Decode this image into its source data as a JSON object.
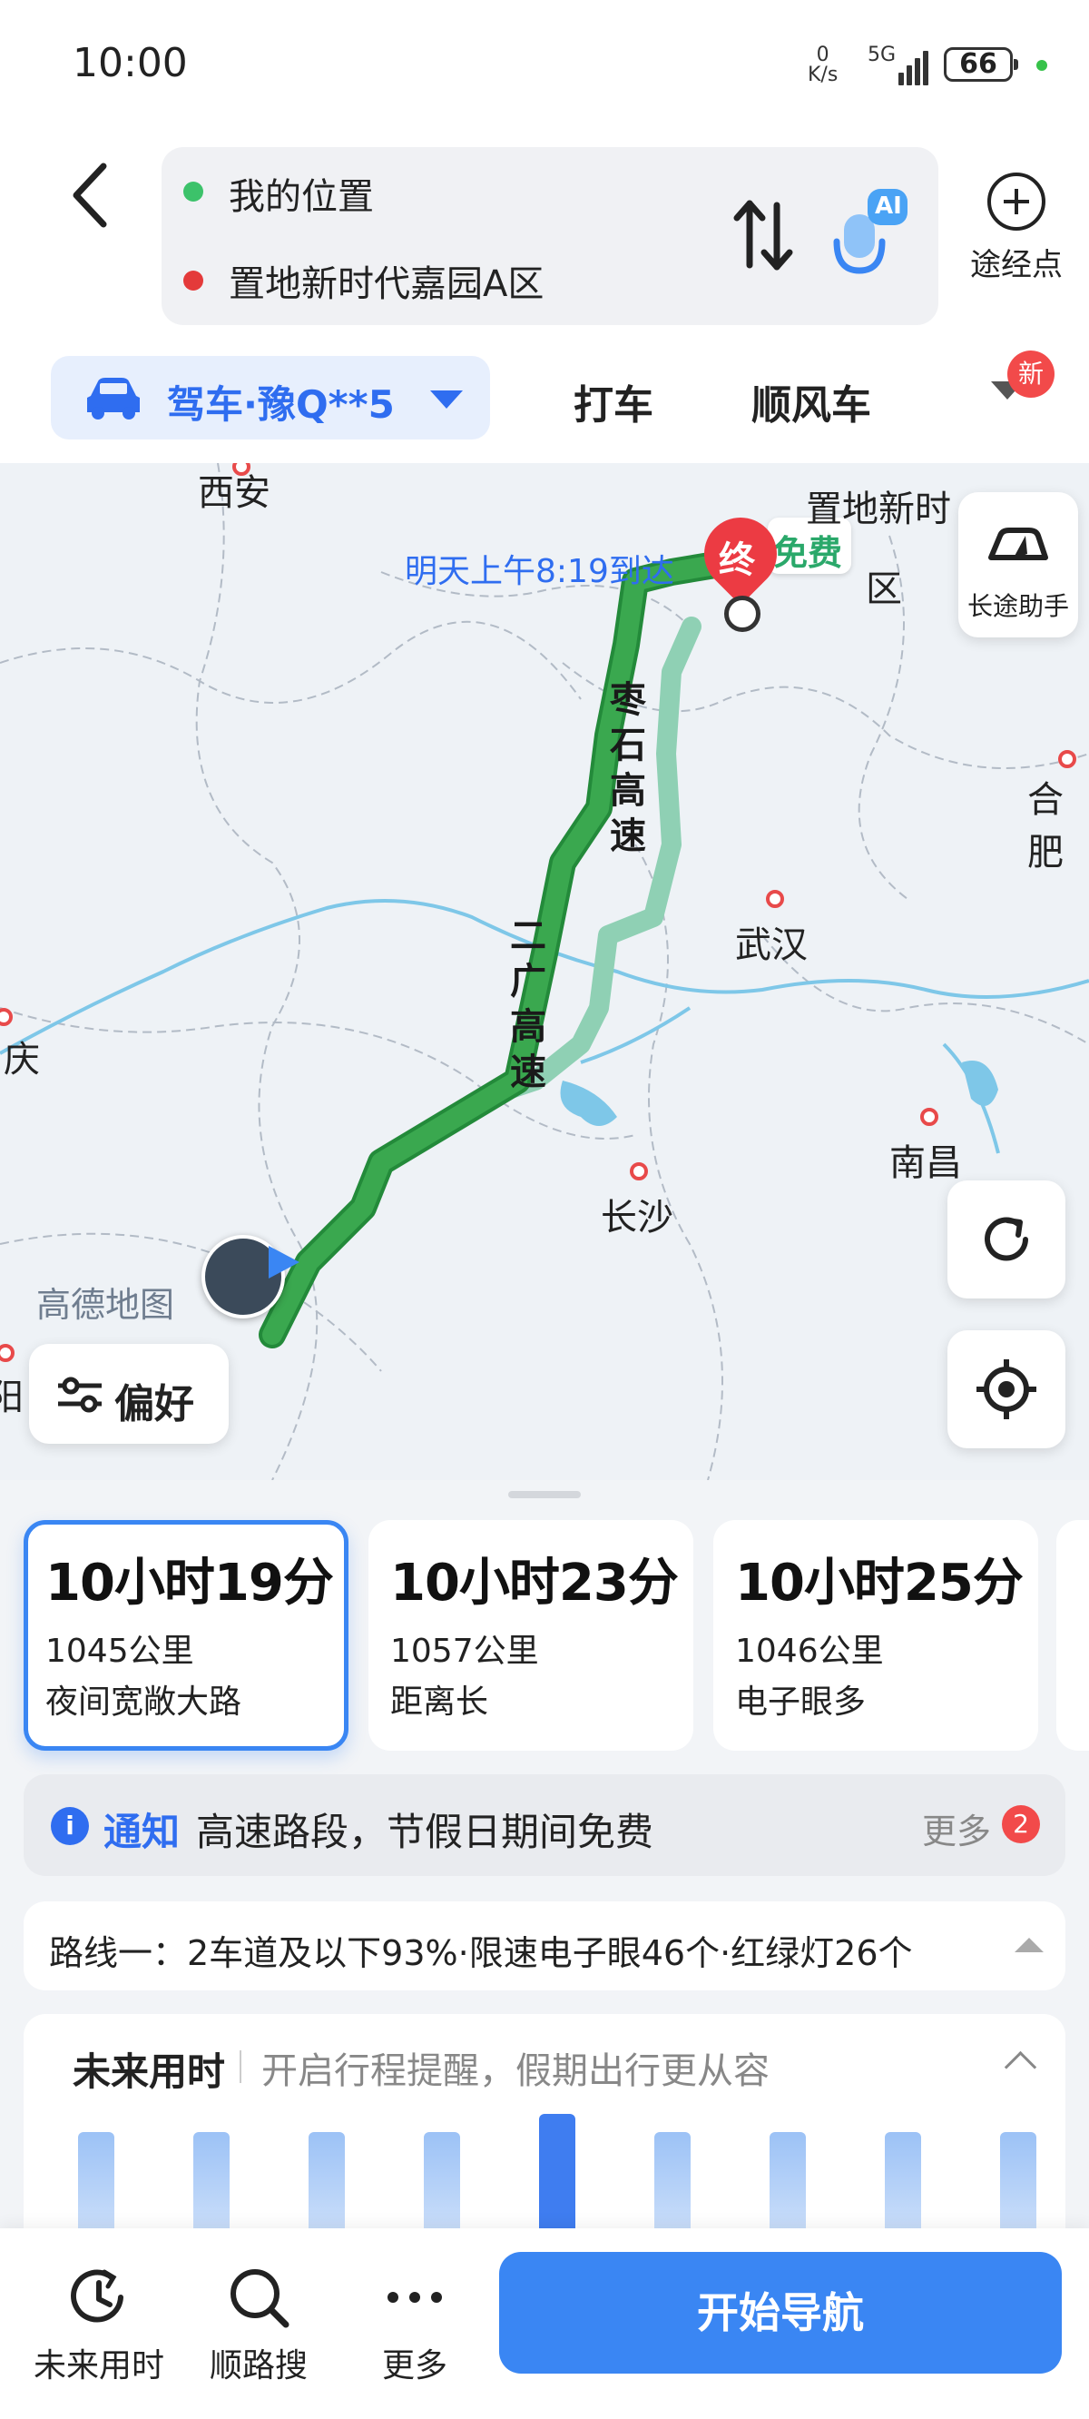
{
  "status_bar": {
    "time": "10:00",
    "net_speed_value": "0",
    "net_speed_unit": "K/s",
    "signal": "5G",
    "battery": "66"
  },
  "header": {
    "origin": "我的位置",
    "destination": "置地新时代嘉园A区",
    "ai_badge": "AI",
    "via_label": "途经点"
  },
  "modes": {
    "drive": "驾车·豫Q**5",
    "taxi": "打车",
    "carpool": "顺风车",
    "new_badge": "新"
  },
  "map": {
    "eta": "明天上午8:19到达",
    "end_marker": "终",
    "toll_free": "免费",
    "dest_label_1": "置地新时",
    "dest_label_2": "区",
    "road_1": [
      "枣",
      "石",
      "高",
      "速"
    ],
    "road_2": [
      "二",
      "广",
      "高",
      "速"
    ],
    "cities": {
      "xian": "西安",
      "wuhan": "武汉",
      "changsha": "长沙",
      "nanchang": "南昌",
      "hefei": "合肥",
      "chongqing": "庆",
      "guiyang": "阳"
    },
    "logo": "高德地图",
    "long_trip": "长途助手",
    "preference": "偏好"
  },
  "routes": [
    {
      "time": "10小时19分",
      "distance": "1045公里",
      "tag": "夜间宽敞大路",
      "selected": true
    },
    {
      "time": "10小时23分",
      "distance": "1057公里",
      "tag": "距离长",
      "selected": false
    },
    {
      "time": "10小时25分",
      "distance": "1046公里",
      "tag": "电子眼多",
      "selected": false
    }
  ],
  "notice": {
    "icon": "i",
    "label": "通知",
    "text": "高速路段，节假日期间免费",
    "more": "更多",
    "count": "2"
  },
  "route_info": "路线一：2车道及以下93%·限速电子眼46个·红绿灯26个",
  "future_time": {
    "title": "未来用时",
    "subtitle": "开启行程提醒，假期出行更从容",
    "bar_levels": [
      0.9,
      0.9,
      0.9,
      0.9,
      1.0,
      0.9,
      0.9,
      0.9,
      0.9
    ],
    "selected_index": 4
  },
  "bottom_nav": {
    "future": "未来用时",
    "search": "顺路搜",
    "more": "更多",
    "start": "开始导航"
  },
  "colors": {
    "accent": "#3a86f3",
    "route_main": "#3aa84f",
    "route_alt": "#8fd0b4",
    "badge_red": "#f24a4a"
  }
}
